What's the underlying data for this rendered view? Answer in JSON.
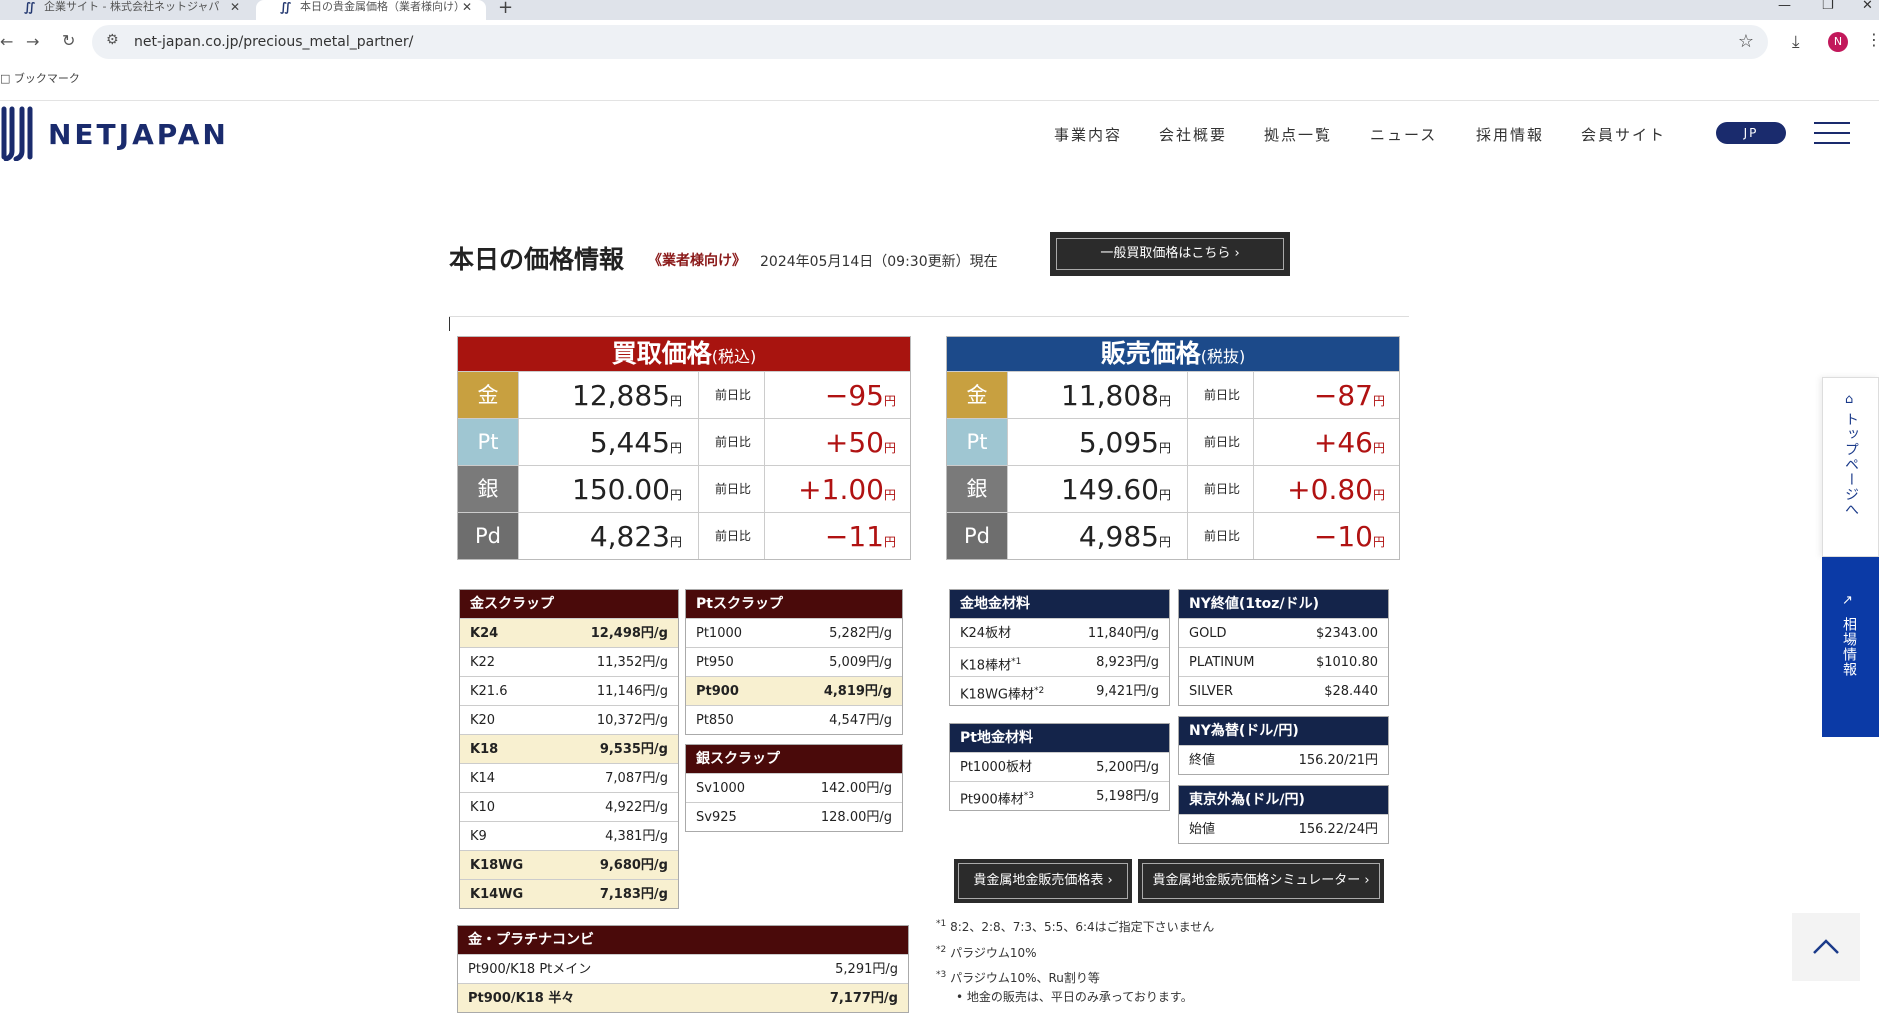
{
  "browser": {
    "tabs": [
      {
        "title": "企業サイト - 株式会社ネットジャパ"
      },
      {
        "title": "本日の貴金属価格（業者様向け）"
      }
    ],
    "url": "net-japan.co.jp/precious_metal_partner/",
    "bookmarks_label": "ブックマーク",
    "profile_initial": "N"
  },
  "header": {
    "logo": "NETJAPAN",
    "nav": [
      "事業内容",
      "会社概要",
      "拠点一覧",
      "ニュース",
      "採用情報",
      "会員サイト"
    ],
    "lang": "JP"
  },
  "title": {
    "main": "本日の価格情報",
    "sub": "《業者様向け》",
    "date": "2024年05月14日（09:30更新）現在",
    "general_button": "一般買取価格はこちら ›"
  },
  "buy": {
    "title": "買取価格",
    "tax": "(税込)",
    "rows": [
      {
        "metal": "金",
        "price": "12,885",
        "label": "前日比",
        "change": "−95"
      },
      {
        "metal": "Pt",
        "price": "5,445",
        "label": "前日比",
        "change": "+50"
      },
      {
        "metal": "銀",
        "price": "150.00",
        "label": "前日比",
        "change": "+1.00"
      },
      {
        "metal": "Pd",
        "price": "4,823",
        "label": "前日比",
        "change": "−11"
      }
    ]
  },
  "sell": {
    "title": "販売価格",
    "tax": "(税抜)",
    "rows": [
      {
        "metal": "金",
        "price": "11,808",
        "label": "前日比",
        "change": "−87"
      },
      {
        "metal": "Pt",
        "price": "5,095",
        "label": "前日比",
        "change": "+46"
      },
      {
        "metal": "銀",
        "price": "149.60",
        "label": "前日比",
        "change": "+0.80"
      },
      {
        "metal": "Pd",
        "price": "4,985",
        "label": "前日比",
        "change": "−10"
      }
    ]
  },
  "yen": "円",
  "gold_scrap": {
    "title": "金スクラップ",
    "rows": [
      {
        "name": "K24",
        "value": "12,498円/g",
        "hl": true
      },
      {
        "name": "K22",
        "value": "11,352円/g",
        "hl": false
      },
      {
        "name": "K21.6",
        "value": "11,146円/g",
        "hl": false
      },
      {
        "name": "K20",
        "value": "10,372円/g",
        "hl": false
      },
      {
        "name": "K18",
        "value": "9,535円/g",
        "hl": true
      },
      {
        "name": "K14",
        "value": "7,087円/g",
        "hl": false
      },
      {
        "name": "K10",
        "value": "4,922円/g",
        "hl": false
      },
      {
        "name": "K9",
        "value": "4,381円/g",
        "hl": false
      },
      {
        "name": "K18WG",
        "value": "9,680円/g",
        "hl": true
      },
      {
        "name": "K14WG",
        "value": "7,183円/g",
        "hl": true
      }
    ]
  },
  "pt_scrap": {
    "title": "Ptスクラップ",
    "rows": [
      {
        "name": "Pt1000",
        "value": "5,282円/g",
        "hl": false
      },
      {
        "name": "Pt950",
        "value": "5,009円/g",
        "hl": false
      },
      {
        "name": "Pt900",
        "value": "4,819円/g",
        "hl": true
      },
      {
        "name": "Pt850",
        "value": "4,547円/g",
        "hl": false
      }
    ]
  },
  "silver_scrap": {
    "title": "銀スクラップ",
    "rows": [
      {
        "name": "Sv1000",
        "value": "142.00円/g",
        "hl": false
      },
      {
        "name": "Sv925",
        "value": "128.00円/g",
        "hl": false
      }
    ]
  },
  "combo": {
    "title": "金・プラチナコンビ",
    "rows": [
      {
        "name": "Pt900/K18 Ptメイン",
        "value": "5,291円/g",
        "hl": false
      },
      {
        "name": "Pt900/K18 半々",
        "value": "7,177円/g",
        "hl": true
      }
    ]
  },
  "gold_material": {
    "title": "金地金材料",
    "rows": [
      {
        "name": "K24板材",
        "value": "11,840円/g",
        "sup": ""
      },
      {
        "name": "K18棒材",
        "value": "8,923円/g",
        "sup": "*1"
      },
      {
        "name": "K18WG棒材",
        "value": "9,421円/g",
        "sup": "*2"
      }
    ]
  },
  "pt_material": {
    "title": "Pt地金材料",
    "rows": [
      {
        "name": "Pt1000板材",
        "value": "5,200円/g",
        "sup": ""
      },
      {
        "name": "Pt900棒材",
        "value": "5,198円/g",
        "sup": "*3"
      }
    ]
  },
  "ny_close": {
    "title": "NY終値(1toz/ドル)",
    "rows": [
      {
        "name": "GOLD",
        "value": "$2343.00"
      },
      {
        "name": "PLATINUM",
        "value": "$1010.80"
      },
      {
        "name": "SILVER",
        "value": "$28.440"
      }
    ]
  },
  "ny_fx": {
    "title": "NY為替(ドル/円)",
    "rows": [
      {
        "name": "終値",
        "value": "156.20/21円"
      }
    ]
  },
  "tokyo_fx": {
    "title": "東京外為(ドル/円)",
    "rows": [
      {
        "name": "始値",
        "value": "156.22/24円"
      }
    ]
  },
  "buttons": {
    "price_table": "貴金属地金販売価格表 ›",
    "simulator": "貴金属地金販売価格シミュレーター ›"
  },
  "notes": {
    "n1_mark": "*1",
    "n1": "8:2、2:8、7:3、5:5、6:4はご指定下さいません",
    "n2_mark": "*2",
    "n2": "パラジウム10%",
    "n3_mark": "*3",
    "n3": "パラジウム10%、Ru割り等",
    "bullet1": "• 地金の販売は、平日のみ承っております。"
  },
  "floating": {
    "top_page": "トップページへ",
    "market": "相場情報"
  },
  "colors": {
    "buy_header": "#a8140f",
    "sell_header": "#1c4a8a",
    "gold": "#c8a040",
    "platinum": "#9fc6d2",
    "silver": "#7a7a7a",
    "palladium": "#6e6e6e",
    "change": "#b01212",
    "navy": "#1a2b6d"
  }
}
